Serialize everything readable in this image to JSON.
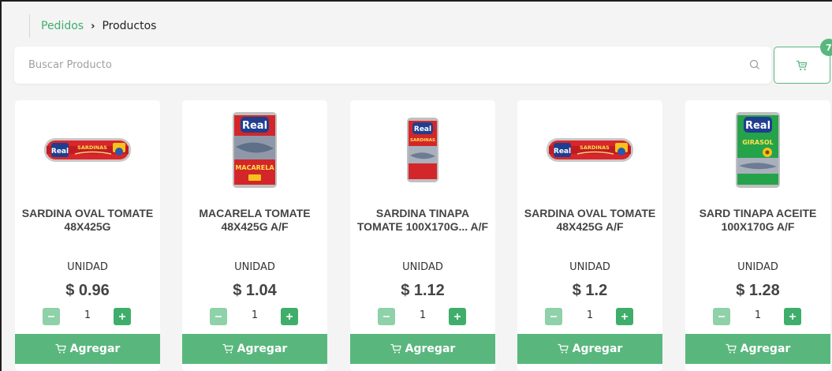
{
  "breadcrumb": {
    "parent": "Pedidos",
    "separator": "›",
    "current": "Productos"
  },
  "search": {
    "placeholder": "Buscar Producto"
  },
  "cart": {
    "count": "7",
    "icon": "cart-icon"
  },
  "colors": {
    "accent": "#59b77e",
    "accent_dark": "#3fae6a",
    "accent_light": "#8fd1a8"
  },
  "products": [
    {
      "name": "SARDINA OVAL TOMATE 48X425G",
      "unit": "UNIDAD",
      "price": "$ 0.96",
      "qty": "1",
      "add_label": "Agregar",
      "image": "oval-can-real-sardinas",
      "image_brand": "Real",
      "image_text": "SARDINAS"
    },
    {
      "name": "MACARELA TOMATE 48X425G A/F",
      "unit": "UNIDAD",
      "price": "$ 1.04",
      "qty": "1",
      "add_label": "Agregar",
      "image": "tall-can-real-macarela",
      "image_brand": "Real",
      "image_text": "MACARELA"
    },
    {
      "name": "SARDINA TINAPA TOMATE 100X170G... A/F",
      "unit": "UNIDAD",
      "price": "$ 1.12",
      "qty": "1",
      "add_label": "Agregar",
      "image": "small-can-real-sardinas",
      "image_brand": "Real",
      "image_text": "SARDINAS"
    },
    {
      "name": "SARDINA OVAL TOMATE 48X425G A/F",
      "unit": "UNIDAD",
      "price": "$ 1.2",
      "qty": "1",
      "add_label": "Agregar",
      "image": "oval-can-real-sardinas",
      "image_brand": "Real",
      "image_text": "SARDINAS"
    },
    {
      "name": "SARD TINAPA ACEITE 100X170G A/F",
      "unit": "UNIDAD",
      "price": "$ 1.28",
      "qty": "1",
      "add_label": "Agregar",
      "image": "green-can-real-girasol",
      "image_brand": "Real",
      "image_text": "GIRASOL"
    }
  ]
}
